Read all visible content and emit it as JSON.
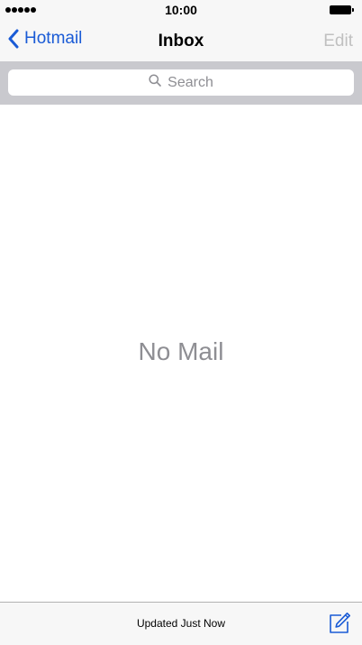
{
  "status_bar": {
    "signal_dots": 5,
    "time": "10:00"
  },
  "nav": {
    "back_label": "Hotmail",
    "title": "Inbox",
    "edit_label": "Edit"
  },
  "search": {
    "placeholder": "Search"
  },
  "main": {
    "empty_message": "No Mail"
  },
  "toolbar": {
    "status": "Updated Just Now"
  },
  "icons": {
    "back": "chevron-left-icon",
    "search": "magnifier-icon",
    "compose": "compose-icon"
  },
  "colors": {
    "accent": "#1a5bd6",
    "disabled": "#c0c0c0",
    "placeholder": "#8e8e93",
    "bar_background": "#f7f7f7",
    "search_background": "#c9c9ce"
  }
}
